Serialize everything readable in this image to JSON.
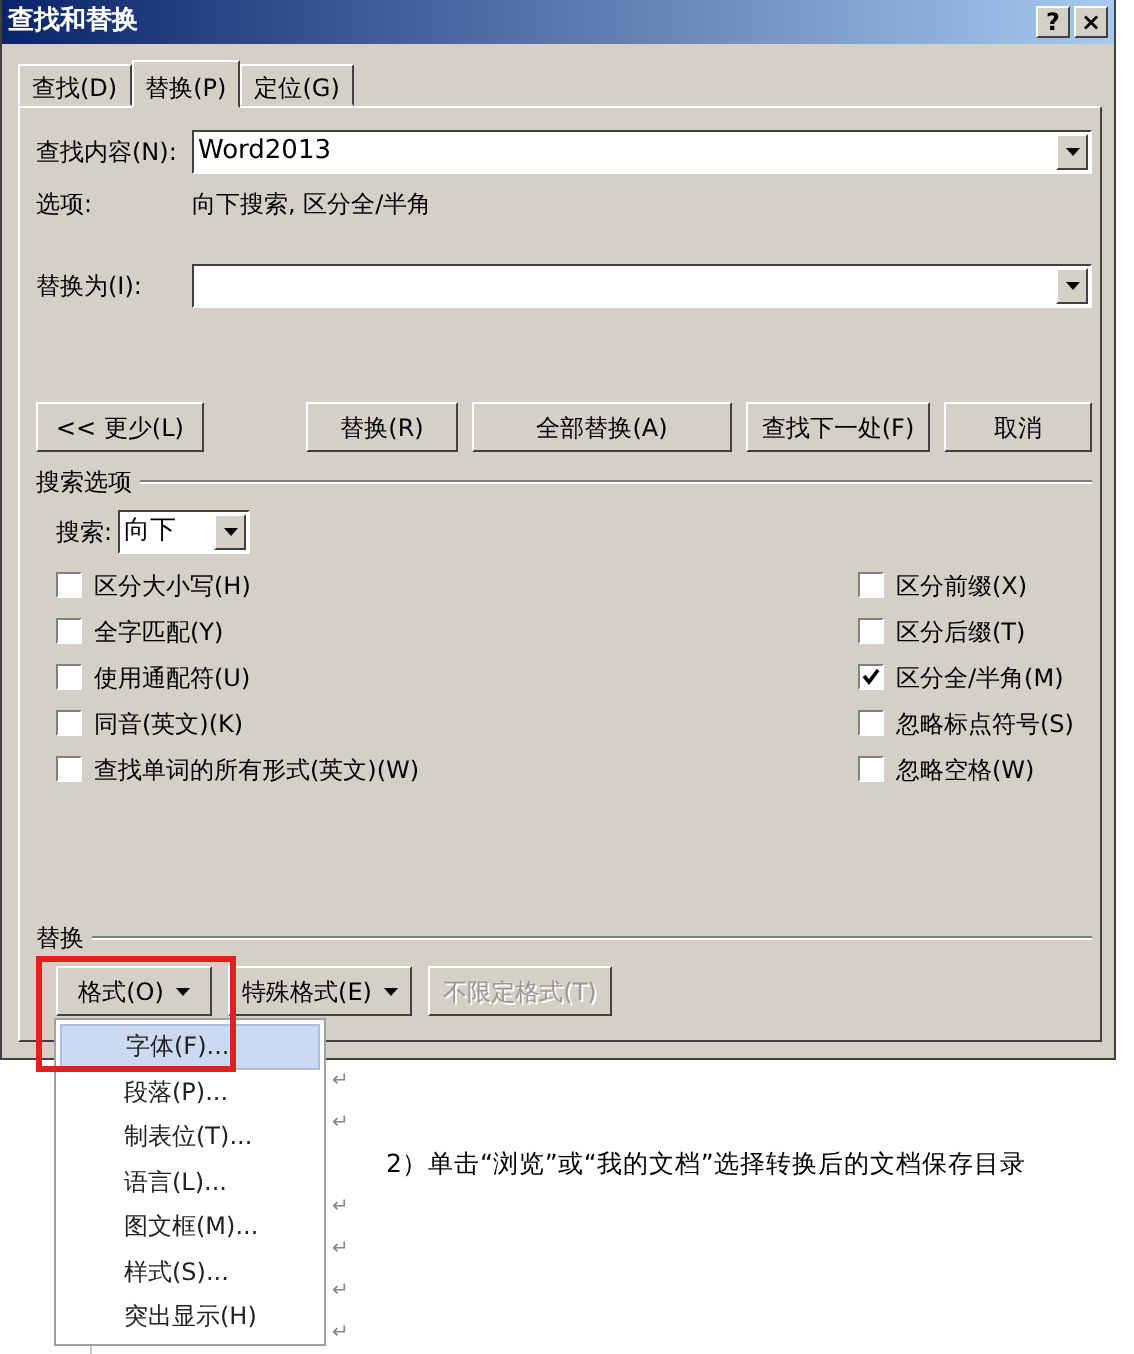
{
  "window": {
    "title": "查找和替换",
    "buttons": [
      "?",
      "×"
    ]
  },
  "tabs": [
    {
      "label": "查找(D)",
      "selected": false
    },
    {
      "label": "替换(P)",
      "selected": true
    },
    {
      "label": "定位(G)",
      "selected": false
    }
  ],
  "find": {
    "label": "查找内容(N):",
    "value": "Word2013"
  },
  "options": {
    "label": "选项:",
    "value": "向下搜索, 区分全/半角"
  },
  "replace": {
    "label": "替换为(I):"
  },
  "buttons": [
    {
      "label": "<< 更少(L)"
    },
    {
      "label": "替换(R)"
    },
    {
      "label": "全部替换(A)"
    },
    {
      "label": "查找下一处(F)"
    },
    {
      "label": "取消"
    }
  ],
  "search_options": {
    "title": "搜索选项",
    "direction": {
      "label": "搜索:",
      "value": "向下"
    },
    "left": [
      {
        "label": "区分大小写(H)",
        "checked": false
      },
      {
        "label": "全字匹配(Y)",
        "checked": false
      },
      {
        "label": "使用通配符(U)",
        "checked": false
      },
      {
        "label": "同音(英文)(K)",
        "checked": false
      },
      {
        "label": "查找单词的所有形式(英文)(W)",
        "checked": false
      }
    ],
    "right": [
      {
        "label": "区分前缀(X)",
        "checked": false
      },
      {
        "label": "区分后缀(T)",
        "checked": false
      },
      {
        "label": "区分全/半角(M)",
        "checked": true
      },
      {
        "label": "忽略标点符号(S)",
        "checked": false
      },
      {
        "label": "忽略空格(W)",
        "checked": false
      }
    ]
  },
  "replace_section": {
    "title": "替换",
    "buttons": [
      {
        "label": "格式(O)",
        "dropdown": true,
        "disabled": false
      },
      {
        "label": "特殊格式(E)",
        "dropdown": true,
        "disabled": false
      },
      {
        "label": "不限定格式(T)",
        "dropdown": false,
        "disabled": true
      }
    ]
  },
  "format_menu": {
    "items": [
      {
        "label": "字体(F)...",
        "selected": true
      },
      {
        "label": "段落(P)...",
        "selected": false
      },
      {
        "label": "制表位(T)...",
        "selected": false
      },
      {
        "label": "语言(L)...",
        "selected": false
      },
      {
        "label": "图文框(M)...",
        "selected": false
      },
      {
        "label": "样式(S)...",
        "selected": false
      },
      {
        "label": "突出显示(H)",
        "selected": false
      }
    ]
  },
  "document": {
    "lines": [
      {
        "kind": "mark",
        "text": "↵"
      },
      {
        "kind": "mark",
        "text": "↵"
      },
      {
        "kind": "text",
        "text": "2）单击“浏览”或“我的文档”选择转换后的文档保存目录"
      },
      {
        "kind": "mark",
        "text": "↵"
      },
      {
        "kind": "mark",
        "text": "↵"
      },
      {
        "kind": "mark",
        "text": "↵"
      },
      {
        "kind": "mark",
        "text": "↵"
      }
    ]
  }
}
